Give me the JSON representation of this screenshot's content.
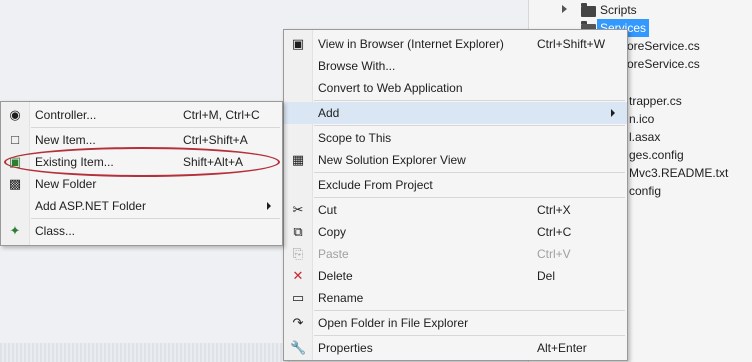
{
  "solution_explorer": {
    "rows": [
      {
        "text": "Scripts",
        "selected": false
      },
      {
        "text": "Services",
        "selected": true
      },
      {
        "text": "oreService.cs"
      },
      {
        "text": "oreService.cs"
      },
      {
        "text": "trapper.cs"
      },
      {
        "text": "n.ico"
      },
      {
        "text": "l.asax"
      },
      {
        "text": "ges.config"
      },
      {
        "text": "Mvc3.README.txt"
      },
      {
        "text": "config"
      }
    ]
  },
  "context_menu": {
    "items": [
      {
        "label": "View in Browser (Internet Explorer)",
        "shortcut": "Ctrl+Shift+W",
        "icon": "browser-icon"
      },
      {
        "label": "Browse With...",
        "shortcut": ""
      },
      {
        "label": "Convert to Web Application",
        "shortcut": ""
      },
      {
        "label": "Add",
        "shortcut": "",
        "submenu": true
      },
      {
        "label": "Scope to This",
        "shortcut": ""
      },
      {
        "label": "New Solution Explorer View",
        "shortcut": "",
        "icon": "solution-view-icon"
      },
      {
        "label": "Exclude From Project",
        "shortcut": ""
      },
      {
        "label": "Cut",
        "shortcut": "Ctrl+X",
        "icon": "cut-icon"
      },
      {
        "label": "Copy",
        "shortcut": "Ctrl+C",
        "icon": "copy-icon"
      },
      {
        "label": "Paste",
        "shortcut": "Ctrl+V",
        "icon": "paste-icon",
        "disabled": true
      },
      {
        "label": "Delete",
        "shortcut": "Del",
        "icon": "delete-icon"
      },
      {
        "label": "Rename",
        "shortcut": "",
        "icon": "rename-icon"
      },
      {
        "label": "Open Folder in File Explorer",
        "shortcut": "",
        "icon": "open-folder-icon"
      },
      {
        "label": "Properties",
        "shortcut": "Alt+Enter",
        "icon": "wrench-icon"
      }
    ]
  },
  "add_submenu": {
    "items": [
      {
        "label": "Controller...",
        "shortcut": "Ctrl+M, Ctrl+C",
        "icon": "controller-icon"
      },
      {
        "label": "New Item...",
        "shortcut": "Ctrl+Shift+A",
        "icon": "new-item-icon"
      },
      {
        "label": "Existing Item...",
        "shortcut": "Shift+Alt+A",
        "icon": "existing-item-icon"
      },
      {
        "label": "New Folder",
        "shortcut": "",
        "icon": "new-folder-icon"
      },
      {
        "label": "Add ASP.NET Folder",
        "shortcut": "",
        "submenu": true
      },
      {
        "label": "Class...",
        "shortcut": "",
        "icon": "class-icon"
      }
    ]
  },
  "colors": {
    "highlight_outline": "#b4303a",
    "selection": "#3399ff",
    "delete_icon": "#c8282c"
  }
}
